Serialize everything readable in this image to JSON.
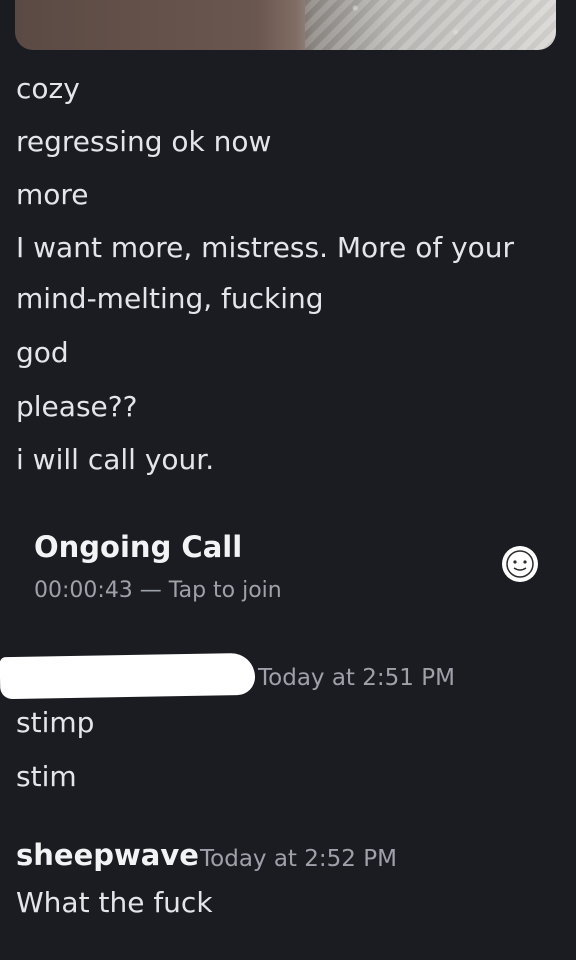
{
  "messages_top": [
    {
      "text": "cozy"
    },
    {
      "text": "regressing ok now"
    },
    {
      "text": "more"
    },
    {
      "text": "I want more, mistress. More of your"
    },
    {
      "text": "mind-melting, fucking"
    },
    {
      "text": "god"
    },
    {
      "text": "please??"
    },
    {
      "text": "i will call your."
    }
  ],
  "call": {
    "title": "Ongoing Call",
    "subtitle": "00:00:43 — Tap to join"
  },
  "group1": {
    "timestamp": "Today at 2:51 PM",
    "messages": [
      "stimp",
      "stim"
    ]
  },
  "group2": {
    "username": "sheepwave",
    "timestamp": "Today at 2:52 PM",
    "message": "What the fuck"
  }
}
